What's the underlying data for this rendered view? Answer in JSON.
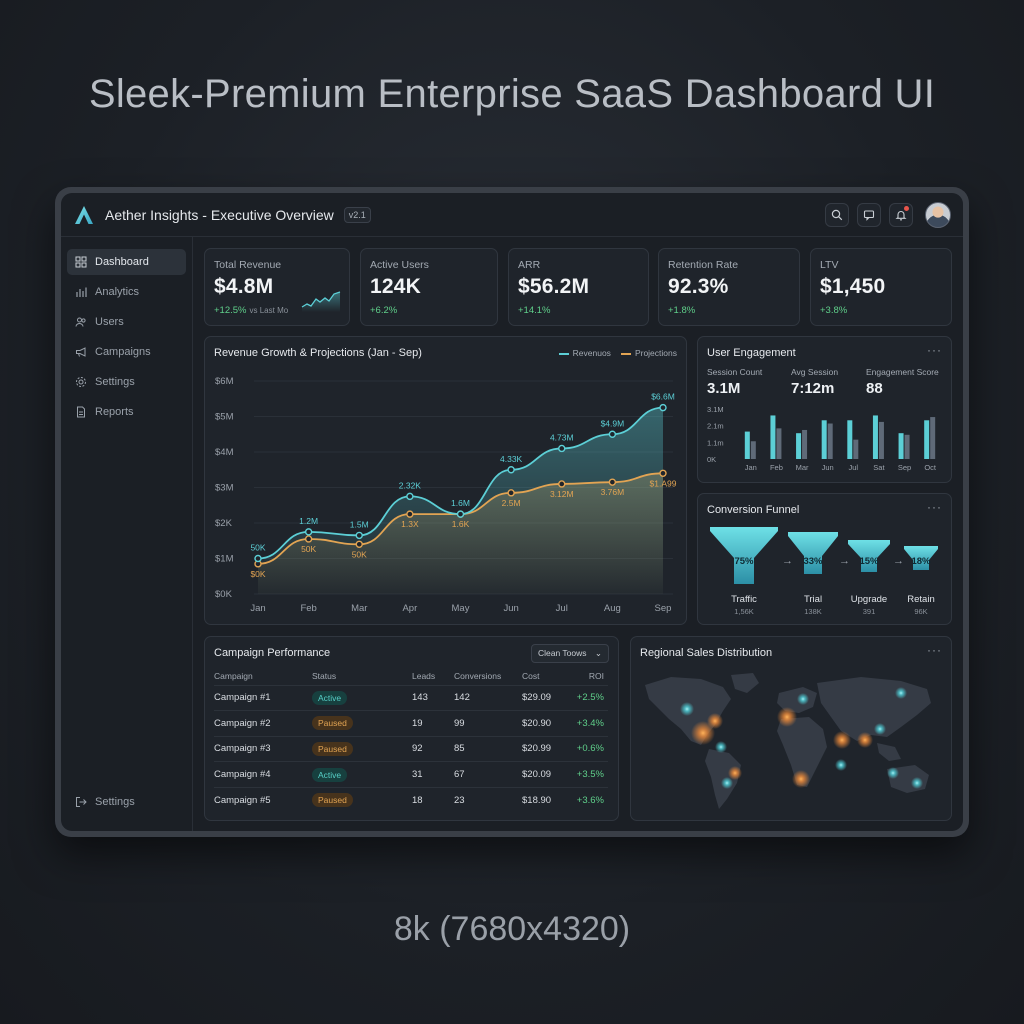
{
  "headline": "Sleek-Premium Enterprise SaaS Dashboard UI",
  "caption": "8k (7680x4320)",
  "app": {
    "title": "Aether Insights - Executive Overview",
    "version": "v2.1"
  },
  "topbar_icons": [
    "search-icon",
    "message-icon",
    "bell-icon"
  ],
  "sidebar": {
    "items": [
      {
        "label": "Dashboard",
        "icon": "grid-icon",
        "active": true
      },
      {
        "label": "Analytics",
        "icon": "bar-chart-icon",
        "active": false
      },
      {
        "label": "Users",
        "icon": "users-icon",
        "active": false
      },
      {
        "label": "Campaigns",
        "icon": "megaphone-icon",
        "active": false
      },
      {
        "label": "Settings",
        "icon": "gear-icon",
        "active": false
      },
      {
        "label": "Reports",
        "icon": "report-icon",
        "active": false
      }
    ],
    "bottom": {
      "label": "Settings",
      "icon": "logout-icon"
    }
  },
  "kpis": [
    {
      "label": "Total Revenue",
      "value": "$4.8M",
      "delta": "+12.5%",
      "note": "vs Last Mo"
    },
    {
      "label": "Active Users",
      "value": "124K",
      "delta": "+6.2%",
      "note": ""
    },
    {
      "label": "ARR",
      "value": "$56.2M",
      "delta": "+14.1%",
      "note": ""
    },
    {
      "label": "Retention Rate",
      "value": "92.3%",
      "delta": "+1.8%",
      "note": ""
    },
    {
      "label": "LTV",
      "value": "$1,450",
      "delta": "+3.8%",
      "note": ""
    }
  ],
  "colors": {
    "accent": "#5ccfd6",
    "projection": "#e2a453",
    "positive": "#5fcf8a",
    "bg": "#1b1f25"
  },
  "revenue_chart": {
    "title": "Revenue Growth & Projections (Jan - Sep)",
    "legend": [
      "Revenuos",
      "Projections"
    ],
    "y_ticks": [
      "$6M",
      "$5M",
      "$4M",
      "$3M",
      "$2K",
      "$1M",
      "$0K"
    ]
  },
  "engagement": {
    "title": "User Engagement",
    "stats": [
      {
        "label": "Session Count",
        "value": "3.1M"
      },
      {
        "label": "Avg Session",
        "value": "7:12m"
      },
      {
        "label": "Engagement Score",
        "value": "88"
      }
    ],
    "y_ticks": [
      "3.1M",
      "2.1m",
      "1.1m",
      "0K"
    ]
  },
  "funnel": {
    "title": "Conversion Funnel",
    "stages": [
      {
        "pct": "75%",
        "name": "Traffic",
        "count": "1,56K"
      },
      {
        "pct": "33%",
        "name": "Trial",
        "count": "138K"
      },
      {
        "pct": "15%",
        "name": "Upgrade",
        "count": "391"
      },
      {
        "pct": "18%",
        "name": "Retain",
        "count": "96K"
      }
    ]
  },
  "campaigns": {
    "title": "Campaign Performance",
    "filter": "Clean Toows",
    "columns": [
      "Campaign",
      "Status",
      "Leads",
      "Conversions",
      "Cost",
      "ROI"
    ],
    "rows": [
      [
        "Campaign #1",
        "Active",
        "143",
        "142",
        "$29.09",
        "+2.5%"
      ],
      [
        "Campaign #2",
        "Paused",
        "19",
        "99",
        "$20.90",
        "+3.4%"
      ],
      [
        "Campaign #3",
        "Paused",
        "92",
        "85",
        "$20.99",
        "+0.6%"
      ],
      [
        "Campaign #4",
        "Active",
        "31",
        "67",
        "$20.09",
        "+3.5%"
      ],
      [
        "Campaign #5",
        "Paused",
        "18",
        "23",
        "$18.90",
        "+3.6%"
      ]
    ]
  },
  "regional": {
    "title": "Regional Sales Distribution"
  },
  "chart_data": [
    {
      "type": "line",
      "title": "Revenue Growth & Projections (Jan - Sep)",
      "categories": [
        "Jan",
        "Feb",
        "Mar",
        "Apr",
        "May",
        "Jun",
        "Jul",
        "Aug",
        "Sep"
      ],
      "ylim": [
        0,
        6
      ],
      "series": [
        {
          "name": "Revenuos",
          "values": [
            1.0,
            1.75,
            1.65,
            2.75,
            2.25,
            3.5,
            4.1,
            4.5,
            5.25
          ],
          "labels": [
            "50K",
            "1.2M",
            "1.5M",
            "2.32K",
            "1.6M",
            "4.33K",
            "4.73M",
            "$4.9M",
            "$6.6M"
          ]
        },
        {
          "name": "Projections",
          "values": [
            0.85,
            1.55,
            1.4,
            2.25,
            2.25,
            2.85,
            3.1,
            3.15,
            3.4
          ],
          "labels": [
            "$0K",
            "50K",
            "50K",
            "1.3X",
            "1.6K",
            "2.5M",
            "3.12M",
            "3.76M",
            "$1.A99"
          ]
        }
      ]
    },
    {
      "type": "bar",
      "title": "User Engagement",
      "categories": [
        "Jan",
        "Feb",
        "Mar",
        "Jun",
        "Jul",
        "Sat",
        "Sep",
        "Oct"
      ],
      "ylim": [
        0,
        3.1
      ],
      "series": [
        {
          "name": "",
          "values": [
            1.7,
            2.7,
            1.6,
            2.4,
            2.4,
            2.7,
            1.6,
            2.4
          ]
        },
        {
          "name": "",
          "values": [
            1.1,
            1.9,
            1.8,
            2.2,
            1.2,
            2.3,
            1.5,
            2.6
          ]
        }
      ]
    }
  ]
}
